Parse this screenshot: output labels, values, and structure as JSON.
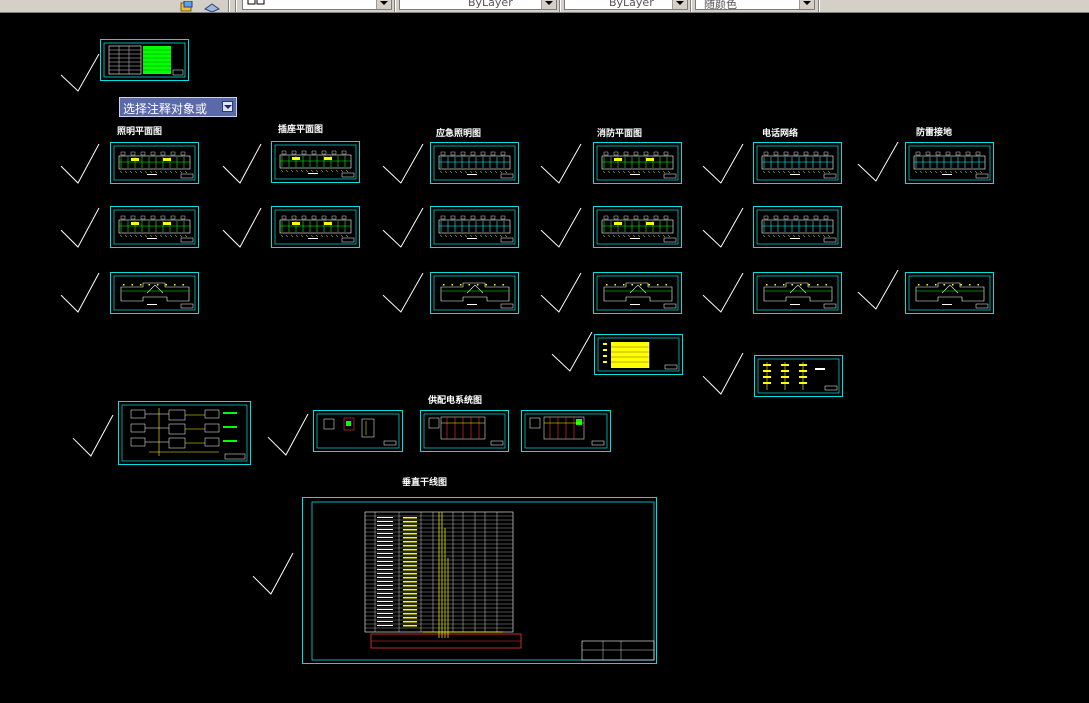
{
  "toolbar": {
    "combo_layer": "",
    "combo_linetype": "ByLayer",
    "combo_lineweight": "ByLayer",
    "combo_color": "随颜色"
  },
  "tooltip": {
    "text": "选择注释对象或"
  },
  "section_labels": {
    "lighting": "照明平面图",
    "socket": "插座平面图",
    "emergency": "应急照明图",
    "fire": "消防平面图",
    "weak": "电话网络",
    "lightning": "防雷接地",
    "power_system": "供配电系统图",
    "riser": "垂直干线图"
  },
  "colors": {
    "background": "#000000",
    "sheet_border": "#00e0e0",
    "check": "#ffffff",
    "drawing_cyan": "#00ffff",
    "drawing_green": "#00ff00",
    "drawing_yellow": "#ffff00",
    "drawing_red": "#ff3030",
    "drawing_magenta": "#ff00ff"
  }
}
